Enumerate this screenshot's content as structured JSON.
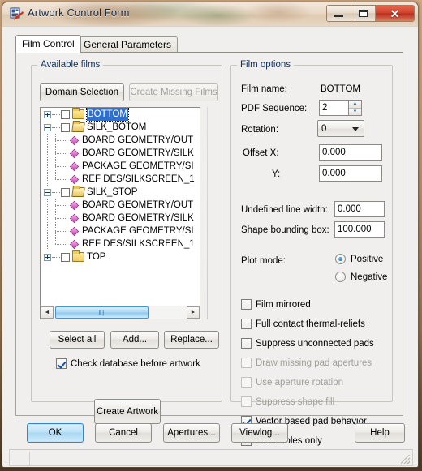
{
  "window": {
    "title": "Artwork Control Form",
    "icon": "app-artwork-icon",
    "minimize_label": "Minimize",
    "maximize_label": "Maximize",
    "close_label": "Close",
    "close_glyph": "✕"
  },
  "tabs": [
    {
      "label": "Film Control",
      "active": true
    },
    {
      "label": "General Parameters",
      "active": false
    }
  ],
  "available_films": {
    "legend": "Available films",
    "domain_selection_button": "Domain Selection",
    "create_missing_films_button": "Create Missing Films",
    "tree": [
      {
        "label": "BOTTOM",
        "level": 0,
        "type": "folder-closed",
        "expander": "plus",
        "checkbox": false,
        "selected": true
      },
      {
        "label": "SILK_BOTOM",
        "level": 0,
        "type": "folder-open",
        "expander": "minus",
        "checkbox": false,
        "selected": false
      },
      {
        "label": "BOARD GEOMETRY/OUT",
        "level": 1,
        "type": "layer",
        "expander": "none",
        "checkbox": null,
        "selected": false
      },
      {
        "label": "BOARD GEOMETRY/SILK",
        "level": 1,
        "type": "layer",
        "expander": "none",
        "checkbox": null,
        "selected": false
      },
      {
        "label": "PACKAGE GEOMETRY/SI",
        "level": 1,
        "type": "layer",
        "expander": "none",
        "checkbox": null,
        "selected": false
      },
      {
        "label": "REF DES/SILKSCREEN_1",
        "level": 1,
        "type": "layer",
        "expander": "none",
        "checkbox": null,
        "selected": false
      },
      {
        "label": "SILK_STOP",
        "level": 0,
        "type": "folder-open",
        "expander": "minus",
        "checkbox": false,
        "selected": false
      },
      {
        "label": "BOARD GEOMETRY/OUT",
        "level": 1,
        "type": "layer",
        "expander": "none",
        "checkbox": null,
        "selected": false
      },
      {
        "label": "BOARD GEOMETRY/SILK",
        "level": 1,
        "type": "layer",
        "expander": "none",
        "checkbox": null,
        "selected": false
      },
      {
        "label": "PACKAGE GEOMETRY/SI",
        "level": 1,
        "type": "layer",
        "expander": "none",
        "checkbox": null,
        "selected": false
      },
      {
        "label": "REF DES/SILKSCREEN_1",
        "level": 1,
        "type": "layer",
        "expander": "none",
        "checkbox": null,
        "selected": false
      },
      {
        "label": "TOP",
        "level": 0,
        "type": "folder-closed",
        "expander": "plus",
        "checkbox": false,
        "selected": false
      }
    ],
    "scrollbar": {
      "left_arrow": "◄",
      "right_arrow": "►",
      "thumb_grip": "‖|"
    },
    "select_all_button": "Select all",
    "add_button": "Add...",
    "replace_button": "Replace...",
    "check_database_checkbox": {
      "label": "Check database before artwork",
      "checked": true
    },
    "create_artwork_button": "Create Artwork"
  },
  "film_options": {
    "legend": "Film options",
    "film_name_label": "Film name:",
    "film_name_value": "BOTTOM",
    "pdf_sequence_label": "PDF Sequence:",
    "pdf_sequence_value": "2",
    "rotation_label": "Rotation:",
    "rotation_value": "0",
    "offset_x_label": "Offset  X:",
    "offset_x_value": "0.000",
    "offset_y_label": "Y:",
    "offset_y_value": "0.000",
    "undefined_line_width_label": "Undefined line width:",
    "undefined_line_width_value": "0.000",
    "shape_bounding_box_label": "Shape bounding box:",
    "shape_bounding_box_value": "100.000",
    "plot_mode_label": "Plot mode:",
    "plot_mode_options": [
      {
        "label": "Positive",
        "selected": true
      },
      {
        "label": "Negative",
        "selected": false
      }
    ],
    "checkboxes": [
      {
        "label": "Film mirrored",
        "checked": false,
        "disabled": false
      },
      {
        "label": "Full contact thermal-reliefs",
        "checked": false,
        "disabled": false
      },
      {
        "label": "Suppress unconnected pads",
        "checked": false,
        "disabled": false
      },
      {
        "label": "Draw missing pad apertures",
        "checked": false,
        "disabled": true
      },
      {
        "label": "Use aperture rotation",
        "checked": false,
        "disabled": true
      },
      {
        "label": "Suppress shape fill",
        "checked": false,
        "disabled": true
      },
      {
        "label": "Vector based pad behavior",
        "checked": true,
        "disabled": false
      },
      {
        "label": "Draw holes only",
        "checked": false,
        "disabled": false
      }
    ]
  },
  "dialog_buttons": [
    {
      "label": "OK",
      "default": true
    },
    {
      "label": "Cancel",
      "default": false
    },
    {
      "label": "Apertures...",
      "default": false
    },
    {
      "label": "Viewlog...",
      "default": false
    },
    {
      "label": "Help",
      "default": false
    }
  ],
  "colors": {
    "accent": "#2f6fd0",
    "title_text": "#1b2c44",
    "legend_text": "#11305c",
    "close_button": "#d0402c",
    "disabled_text": "#a0a09b"
  }
}
